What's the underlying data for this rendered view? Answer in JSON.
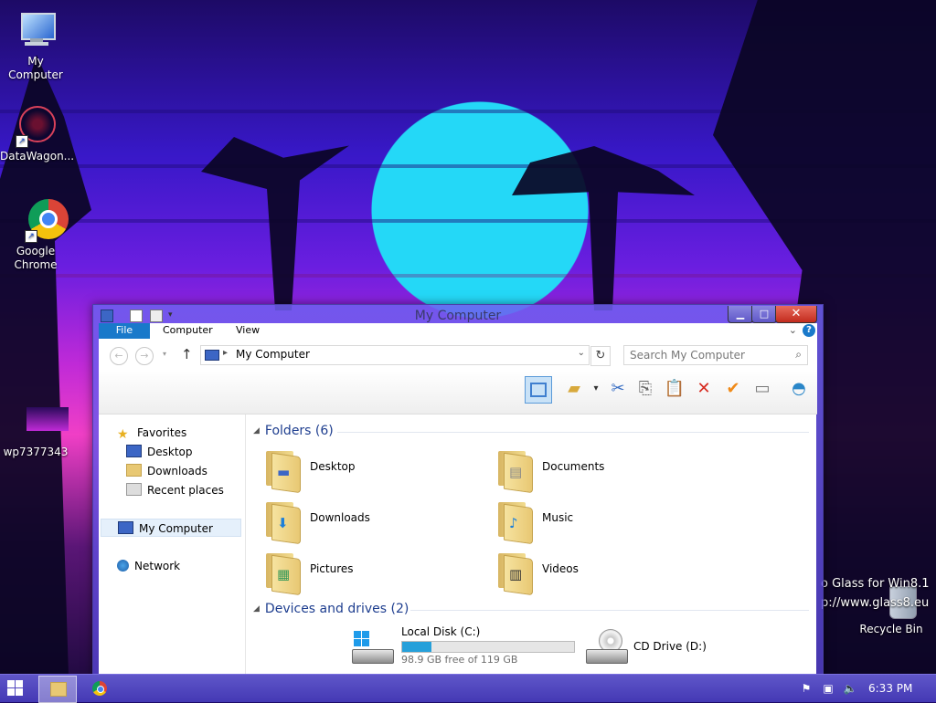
{
  "desktop": {
    "icons": [
      {
        "label": "My Computer"
      },
      {
        "label": "DataWagon..."
      },
      {
        "label": "Google\nChrome"
      },
      {
        "label": "wp7377343"
      },
      {
        "label": "Recycle Bin"
      }
    ],
    "watermark_line1": "o Glass for Win8.1",
    "watermark_line2": "p://www.glass8.eu"
  },
  "window": {
    "title": "My Computer",
    "ribbon_tabs": [
      "File",
      "Computer",
      "View"
    ],
    "address": "My Computer",
    "search_placeholder": "Search My Computer",
    "nav": {
      "favorites": "Favorites",
      "desktop": "Desktop",
      "downloads": "Downloads",
      "recent": "Recent places",
      "computer": "My Computer",
      "network": "Network"
    },
    "folders_header": "Folders (6)",
    "folders": [
      "Desktop",
      "Documents",
      "Downloads",
      "Music",
      "Pictures",
      "Videos"
    ],
    "drives_header": "Devices and drives (2)",
    "drives": [
      {
        "name": "Local Disk (C:)",
        "free": "98.9 GB free of 119 GB",
        "used_fraction": 0.17
      },
      {
        "name": "CD Drive (D:)"
      }
    ]
  },
  "taskbar": {
    "clock": "6:33 PM"
  },
  "colors": {
    "accent": "#1979ca",
    "drive_fill": "#26a0da",
    "close": "#c22b1d"
  }
}
